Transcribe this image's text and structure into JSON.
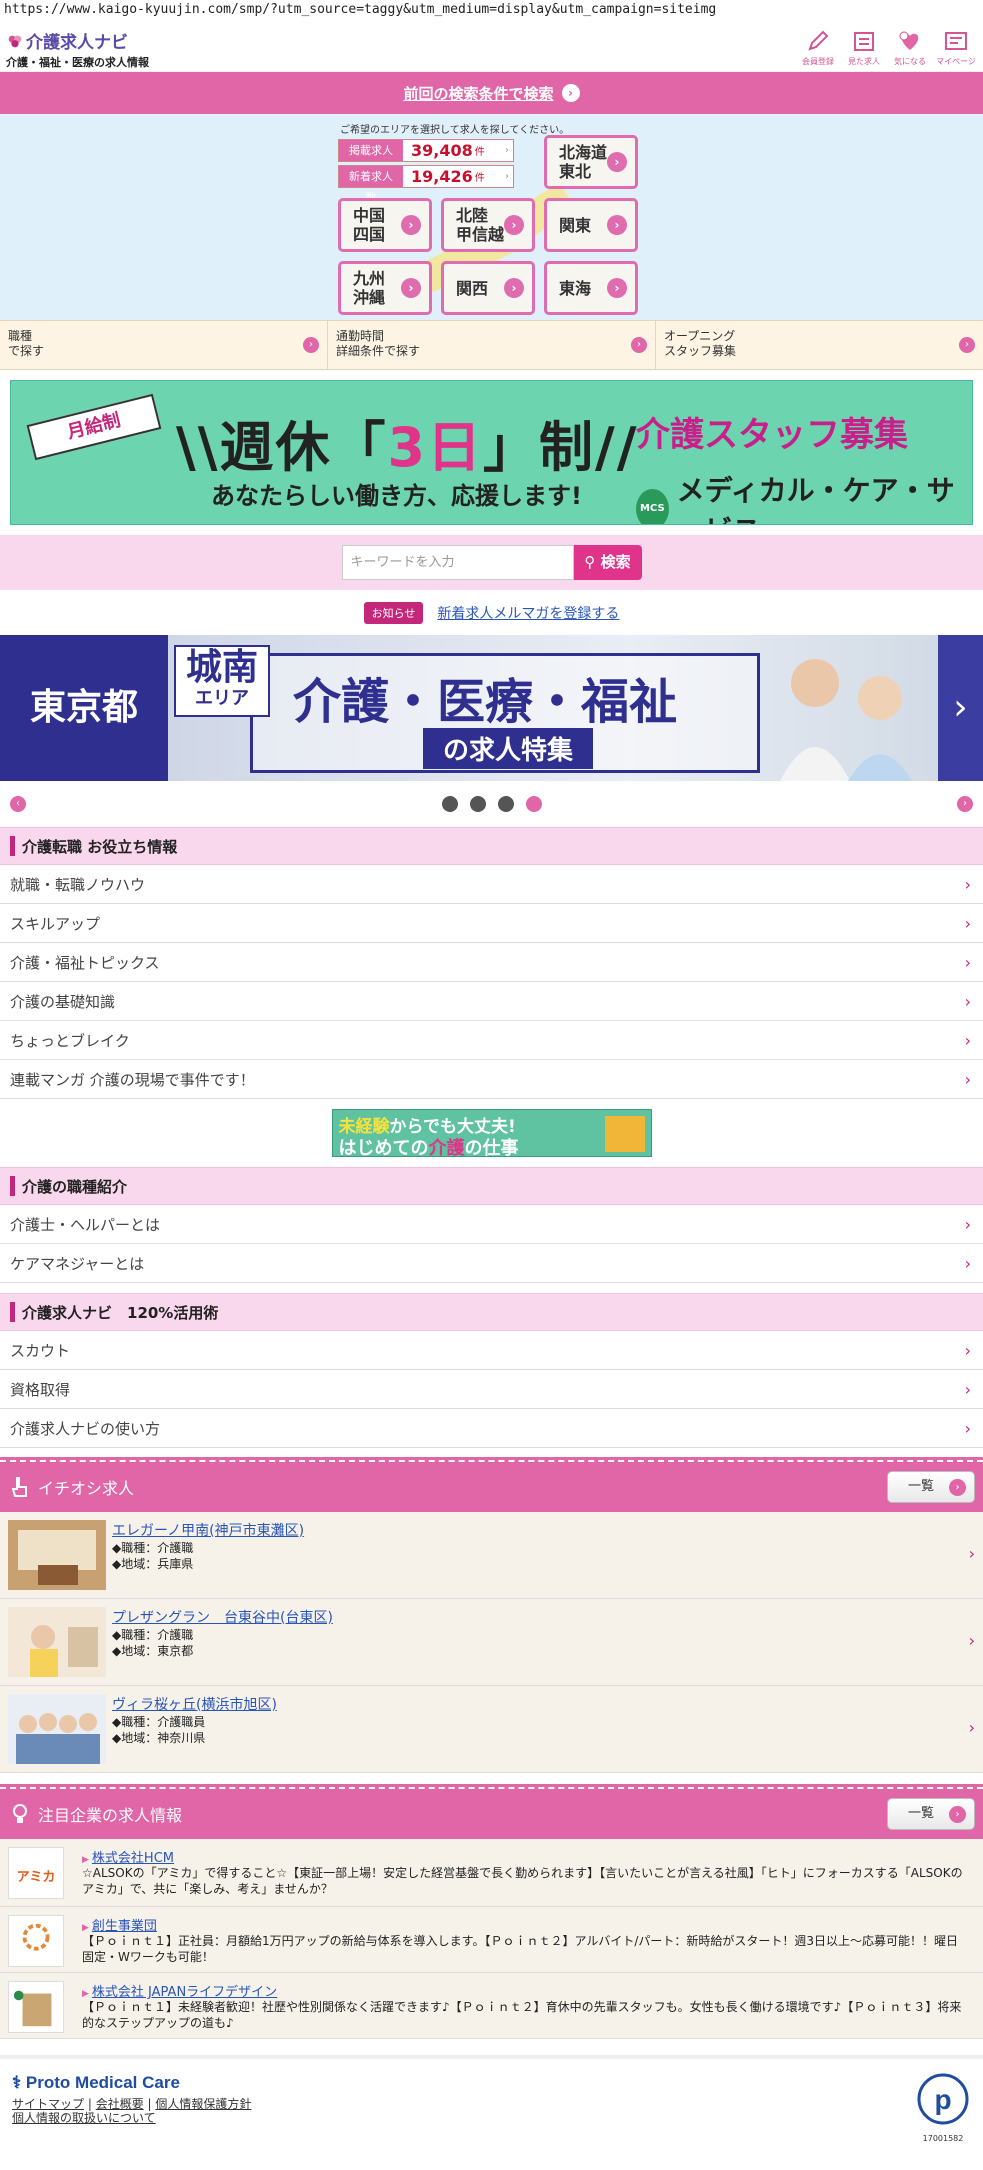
{
  "url": "https://www.kaigo-kyuujin.com/smp/?utm_source=taggy&utm_medium=display&utm_campaign=siteimg",
  "header": {
    "logo_main": "介護求人ナビ",
    "logo_sub": "介護・福祉・医療の求人情報",
    "icons": [
      {
        "label": "会員登録",
        "icon": "pencil-icon"
      },
      {
        "label": "見た求人",
        "icon": "calendar-icon"
      },
      {
        "label": "気になる",
        "icon": "heart-icon"
      },
      {
        "label": "マイページ",
        "icon": "mypage-icon"
      }
    ]
  },
  "prev_search": "前回の検索条件で検索",
  "area": {
    "message": "ご希望のエリアを選択して求人を探してください。",
    "listed_label": "掲載求人数",
    "listed_count": "39,408",
    "new_label": "新着求人数",
    "new_count": "19,426",
    "unit": "件",
    "regions": [
      "北海道\n東北",
      "中国\n四国",
      "北陸\n甲信越",
      "関東",
      "九州\n沖縄",
      "関西",
      "東海"
    ]
  },
  "subnav": [
    "職種\nで探す",
    "通勤時間\n詳細条件で探す",
    "オープニング\nスタッフ募集"
  ],
  "banner1": {
    "ribbon": "月給制",
    "headline_a": "\\\\週休「",
    "headline_num": "3日",
    "headline_b": "」制//",
    "sub": "あなたらしい働き方、応援します!",
    "right_title": "介護スタッフ募集",
    "company": "メディカル・ケア・サービス",
    "logo_text": "MCS"
  },
  "keyword": {
    "placeholder": "キーワードを入力",
    "button": "検索"
  },
  "notice": {
    "tag": "お知らせ",
    "link": "新着求人メルマガを登録する"
  },
  "banner2": {
    "pref": "東京都",
    "area": "城南",
    "area_sub": "エリア",
    "title": "介護・医療・福祉",
    "sub": "の求人特集",
    "next": "›"
  },
  "carousel": {
    "dots": 4,
    "active": 3
  },
  "sections": [
    {
      "title": "介護転職 お役立ち情報",
      "items": [
        "就職・転職ノウハウ",
        "スキルアップ",
        "介護・福祉トピックス",
        "介護の基礎知識",
        "ちょっとブレイク",
        "連載マンガ 介護の現場で事件です！"
      ]
    },
    {
      "title": "介護の職種紹介",
      "items": [
        "介護士・ヘルパーとは",
        "ケアマネジャーとは"
      ]
    },
    {
      "title": "介護求人ナビ　120%活用術",
      "items": [
        "スカウト",
        "資格取得",
        "介護求人ナビの使い方"
      ]
    }
  ],
  "mid_banner": {
    "l1a": "未経験",
    "l1b": "からでも大丈夫!",
    "l2a": "はじめての",
    "l2b": "介護",
    "l2c": "の仕事"
  },
  "pickup": {
    "title": "イチオシ求人",
    "list_btn": "一覧",
    "jobs": [
      {
        "name": "エレガーノ甲南(神戸市東灘区)",
        "type": "◆職種：介護職",
        "area": "◆地域：兵庫県"
      },
      {
        "name": "プレザングラン　台東谷中(台東区)",
        "type": "◆職種：介護職",
        "area": "◆地域：東京都"
      },
      {
        "name": "ヴィラ桜ヶ丘(横浜市旭区)",
        "type": "◆職種：介護職員",
        "area": "◆地域：神奈川県"
      }
    ]
  },
  "featured": {
    "title": "注目企業の求人情報",
    "list_btn": "一覧",
    "companies": [
      {
        "name": "株式会社HCM",
        "desc": "☆ALSOKの「アミカ」で得すること☆【東証一部上場！安定した経営基盤で長く勤められます】【言いたいことが言える社風】「ヒト」にフォーカスする「ALSOKのアミカ」で、共に「楽しみ、考え」ませんか？",
        "logo": "アミカ"
      },
      {
        "name": "創生事業団",
        "desc": "【Ｐｏｉｎｔ１】正社員：月額給1万円アップの新給与体系を導入します。【Ｐｏｉｎｔ２】アルバイト/パート：新時給がスタート！週3日以上〜応募可能！！曜日固定・Wワークも可能！",
        "logo": ""
      },
      {
        "name": "株式会社 JAPANライフデザイン",
        "desc": "【Ｐｏｉｎｔ１】未経験者歓迎！社歴や性別関係なく活躍できます♪【Ｐｏｉｎｔ２】育休中の先輩スタッフも。女性も長く働ける環境です♪【Ｐｏｉｎｔ３】将来的なステップアップの道も♪",
        "logo": ""
      }
    ]
  },
  "footer": {
    "brand": "Proto Medical Care",
    "links_a": "サイトマップ",
    "links_b": "会社概要",
    "links_c": "個人情報保護方針",
    "links_d": "個人情報の取扱いについて",
    "pmark_num": "17001582"
  }
}
